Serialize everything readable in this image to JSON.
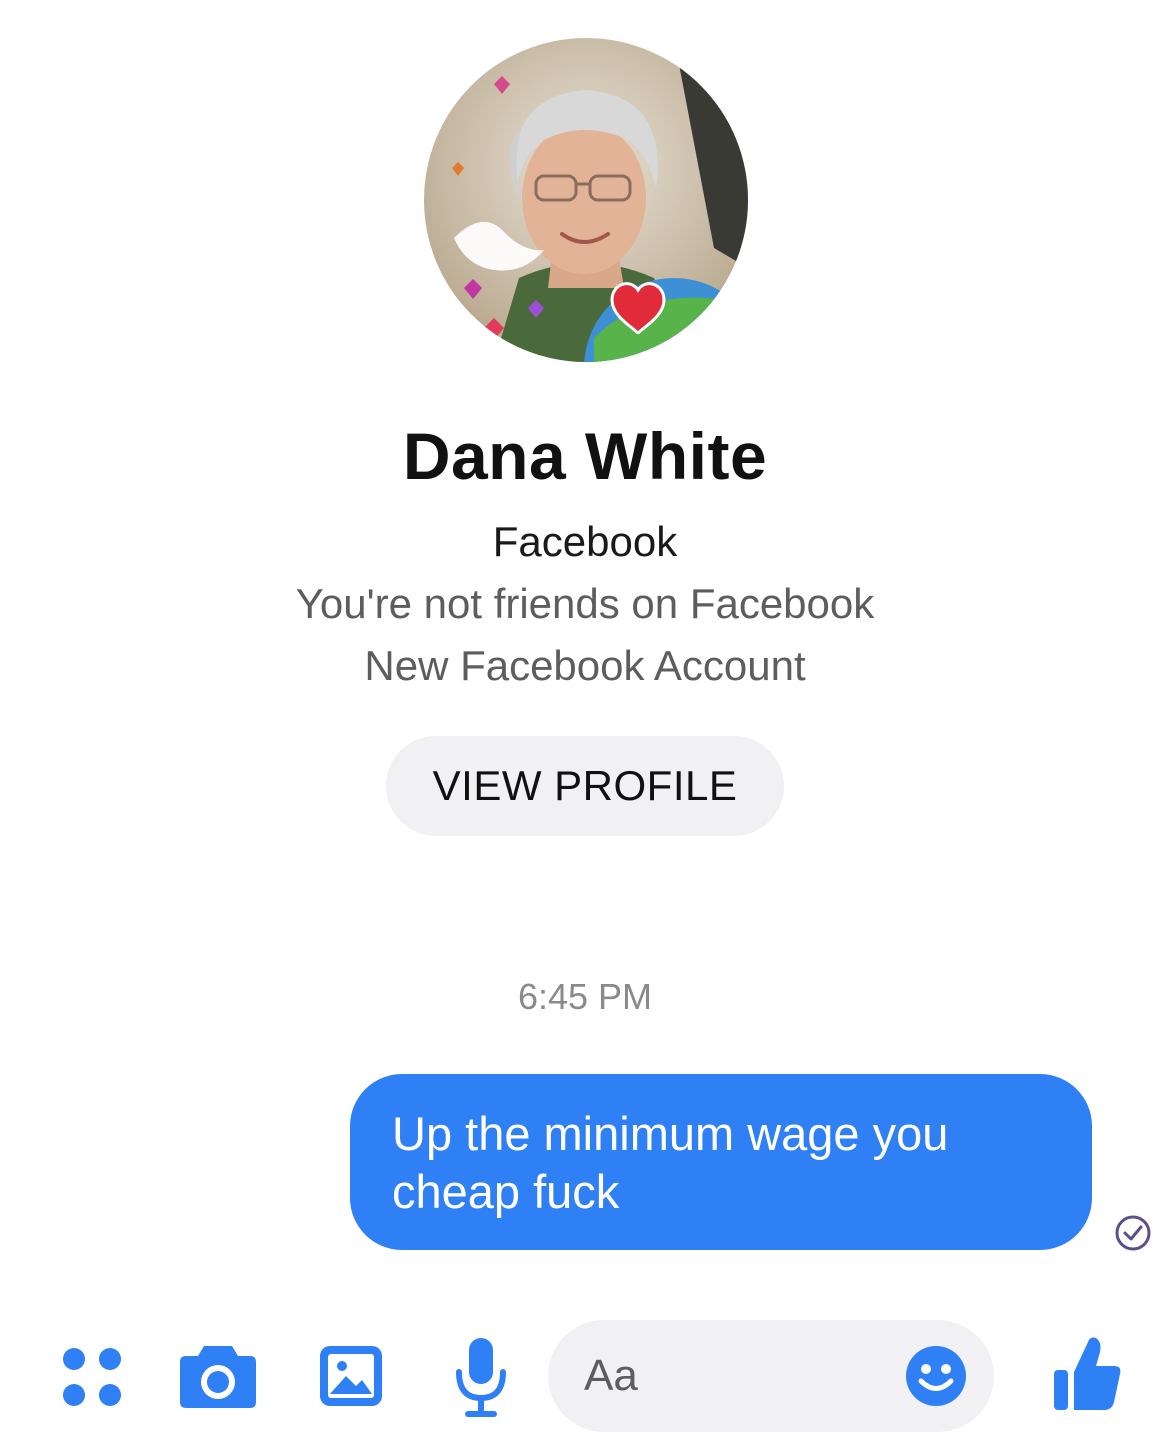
{
  "contact": {
    "name": "Dana White",
    "source": "Facebook",
    "friend_status": "You're not friends on Facebook",
    "account_note": "New Facebook Account",
    "view_profile_label": "VIEW PROFILE"
  },
  "thread": {
    "timestamp": "6:45 PM",
    "messages": [
      {
        "from": "me",
        "text": "Up the minimum wage you cheap fuck",
        "status": "sent"
      }
    ]
  },
  "composer": {
    "placeholder": "Aa",
    "icons": [
      "apps-icon",
      "camera-icon",
      "gallery-icon",
      "microphone-icon",
      "emoji-icon",
      "thumbs-up-icon"
    ]
  },
  "colors": {
    "accent": "#2f7ff5",
    "secondary_text": "#5d5d60",
    "pill_background": "#f1f1f3"
  }
}
